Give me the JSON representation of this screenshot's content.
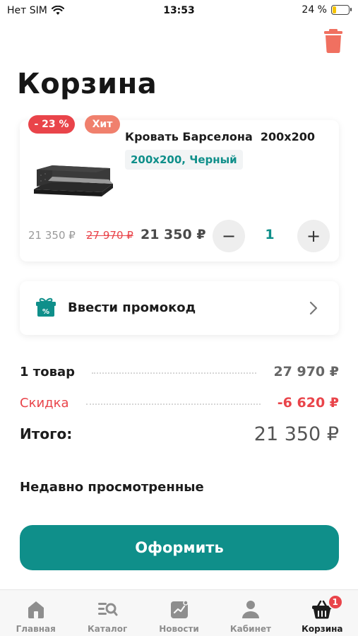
{
  "status_bar": {
    "carrier": "Нет SIM",
    "time": "13:53",
    "battery_text": "24 %",
    "battery_level": 0.24,
    "icons": [
      "wifi-icon",
      "battery-icon"
    ]
  },
  "header": {
    "title": "Корзина",
    "trash_icon": "trash-icon"
  },
  "cart_item": {
    "discount_badge": "- 23 %",
    "hit_badge": "Хит",
    "name": "Кровать Барселона  200x200",
    "variant": "200x200, Черный",
    "price_small": "21 350 ₽",
    "price_old": "27 970 ₽",
    "price_new": "21 350 ₽",
    "quantity": "1",
    "minus_label": "−",
    "plus_label": "+"
  },
  "promo": {
    "label": "Ввести промокод",
    "icon": "gift-percent-icon"
  },
  "summary": {
    "items_label": "1 товар",
    "items_value": "27 970 ₽",
    "discount_label": "Скидка",
    "discount_value": "-6 620 ₽",
    "total_label": "Итого:",
    "total_value": "21 350 ₽"
  },
  "recent": {
    "title": "Недавно просмотренные"
  },
  "checkout": {
    "label": "Оформить"
  },
  "tab_bar": {
    "tabs": [
      {
        "label": "Главная",
        "icon": "home-icon"
      },
      {
        "label": "Каталог",
        "icon": "catalog-icon"
      },
      {
        "label": "Новости",
        "icon": "news-icon"
      },
      {
        "label": "Кабинет",
        "icon": "profile-icon"
      },
      {
        "label": "Корзина",
        "icon": "basket-icon",
        "badge": "1",
        "active": true
      }
    ]
  },
  "colors": {
    "accent": "#0f8f8a",
    "discount": "#e9444a",
    "hit": "#f0806d",
    "trash": "#f07060"
  }
}
